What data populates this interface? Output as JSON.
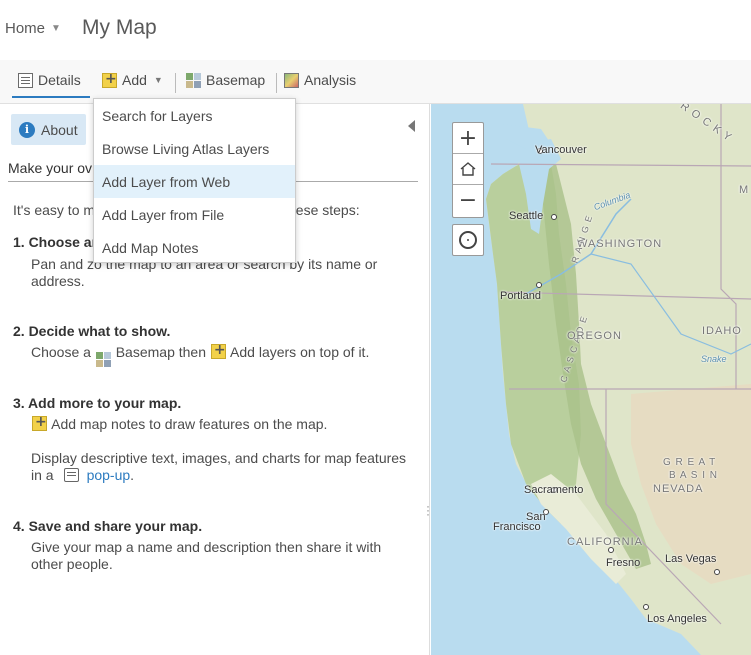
{
  "header": {
    "home_label": "Home",
    "map_title": "My Map"
  },
  "toolbar": {
    "details_label": "Details",
    "add_label": "Add",
    "basemap_label": "Basemap",
    "analysis_label": "Analysis"
  },
  "add_menu": {
    "items": [
      {
        "label": "Search for Layers"
      },
      {
        "label": "Browse Living Atlas Layers"
      },
      {
        "label": "Add Layer from Web"
      },
      {
        "label": "Add Layer from File"
      },
      {
        "label": "Add Map Notes"
      }
    ],
    "active_index": 2
  },
  "panel": {
    "about_label": "About",
    "heading": "Make your ov",
    "intro": "It's easy to m",
    "intro_tail": "hese steps:",
    "steps": [
      {
        "title": "1. Choose ar",
        "text_line1": "Pan and zo",
        "text_line2": "address."
      },
      {
        "title": "2. Decide what to show.",
        "text_before": "Choose a",
        "basemap_word": "Basemap then",
        "add_text": "Add layers on top of it."
      },
      {
        "title": "3. Add more to your map.",
        "notes_text": "Add map notes to draw features on the map.",
        "display_line1": "Display descriptive text, images, and charts for map features",
        "display_in_a": "in a",
        "popup_link": "pop-up",
        "popup_tail": "."
      },
      {
        "title": "4. Save and share your map.",
        "text_line1": "Give your map a name and description then share it with",
        "text_line2": "other people."
      }
    ],
    "step1_tail": "the map to an area or search by its name or"
  },
  "map": {
    "zoom_in": "+",
    "zoom_out": "−",
    "labels": {
      "rocky": "R O C K Y",
      "vancouver": "Vancouver",
      "seattle": "Seattle",
      "columbia": "Columbia",
      "washington": "WASHINGTON",
      "portland": "Portland",
      "cascade": "C A S C A D E",
      "range": "R A N G E",
      "oregon": "OREGON",
      "idaho": "IDAHO",
      "snake": "Snake",
      "great": "G R E A T",
      "basin": "B A S I N",
      "nevada": "NEVADA",
      "sacramento": "Sacramento",
      "san": "San",
      "francisco": "Francisco",
      "california": "CALIFORNIA",
      "fresno": "Fresno",
      "las_vegas": "Las Vegas",
      "los_angeles": "Los Angeles",
      "m": "M"
    }
  },
  "colors": {
    "accent": "#2c7bc0",
    "active_menu_bg": "#e2f1fb",
    "about_bg": "#d8e8f5",
    "ocean": "#b9dcef"
  }
}
